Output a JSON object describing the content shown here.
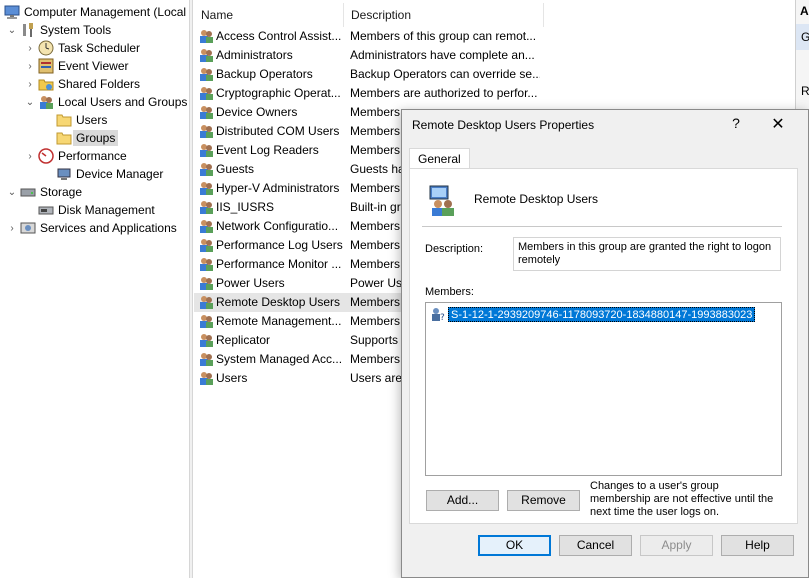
{
  "tree": {
    "root": "Computer Management (Local",
    "system_tools": "System Tools",
    "task_scheduler": "Task Scheduler",
    "event_viewer": "Event Viewer",
    "shared_folders": "Shared Folders",
    "local_users_groups": "Local Users and Groups",
    "users": "Users",
    "groups": "Groups",
    "performance": "Performance",
    "device_manager": "Device Manager",
    "storage": "Storage",
    "disk_management": "Disk Management",
    "services_apps": "Services and Applications"
  },
  "list": {
    "col_name": "Name",
    "col_desc": "Description",
    "rows": [
      {
        "name": "Access Control Assist...",
        "desc": "Members of this group can remot..."
      },
      {
        "name": "Administrators",
        "desc": "Administrators have complete an..."
      },
      {
        "name": "Backup Operators",
        "desc": "Backup Operators can override se..."
      },
      {
        "name": "Cryptographic Operat...",
        "desc": "Members are authorized to perfor..."
      },
      {
        "name": "Device Owners",
        "desc": "Members"
      },
      {
        "name": "Distributed COM Users",
        "desc": "Members"
      },
      {
        "name": "Event Log Readers",
        "desc": "Members"
      },
      {
        "name": "Guests",
        "desc": "Guests hav"
      },
      {
        "name": "Hyper-V Administrators",
        "desc": "Members"
      },
      {
        "name": "IIS_IUSRS",
        "desc": "Built-in gr"
      },
      {
        "name": "Network Configuratio...",
        "desc": "Members"
      },
      {
        "name": "Performance Log Users",
        "desc": "Members"
      },
      {
        "name": "Performance Monitor ...",
        "desc": "Members"
      },
      {
        "name": "Power Users",
        "desc": "Power Use"
      },
      {
        "name": "Remote Desktop Users",
        "desc": "Members"
      },
      {
        "name": "Remote Management...",
        "desc": "Members"
      },
      {
        "name": "Replicator",
        "desc": "Supports f"
      },
      {
        "name": "System Managed Acc...",
        "desc": "Members"
      },
      {
        "name": "Users",
        "desc": "Users are p"
      }
    ]
  },
  "actions": {
    "a": "A",
    "g": "G",
    "r": "R"
  },
  "dialog": {
    "title": "Remote Desktop Users Properties",
    "help_glyph": "?",
    "close_glyph": "✕",
    "tab_general": "General",
    "group_name": "Remote Desktop Users",
    "desc_label": "Description:",
    "desc_value": "Members in this group are granted the right to logon remotely",
    "members_label": "Members:",
    "members": [
      "S-1-12-1-2939209746-1178093720-1834880147-1993883023"
    ],
    "add": "Add...",
    "remove": "Remove",
    "note": "Changes to a user's group membership are not effective until the next time the user logs on.",
    "ok": "OK",
    "cancel": "Cancel",
    "apply": "Apply",
    "help": "Help"
  }
}
